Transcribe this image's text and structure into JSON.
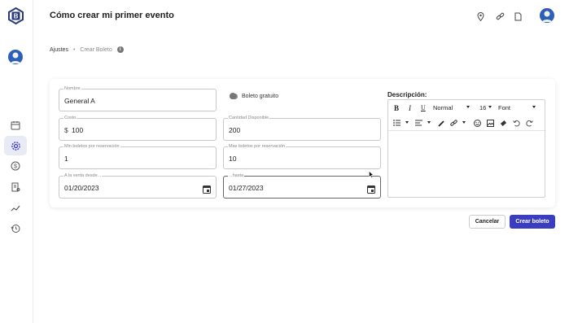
{
  "header": {
    "title": "Cómo crear mi primer evento"
  },
  "breadcrumb": {
    "item1": "Ajustes",
    "separator": "•",
    "item2": "Crear Boleto",
    "info": "i"
  },
  "form": {
    "nombre": {
      "label": "Nombre",
      "value": "General A"
    },
    "boleto_gratuito": {
      "label": "Boleto gratuito"
    },
    "costo": {
      "label": "Costo",
      "prefix": "$",
      "value": "100"
    },
    "cantidad": {
      "label": "Cantidad Disponible",
      "value": "200"
    },
    "min_boletos": {
      "label": "Min boletos por reservación",
      "value": "1"
    },
    "max_boletos": {
      "label": "Max boletos por reservación",
      "value": "10"
    },
    "venta_desde": {
      "label": "A la venta desde...",
      "value": "01/20/2023"
    },
    "hasta": {
      "label": "...hasta",
      "value": "01/27/2023"
    }
  },
  "descripcion": {
    "label": "Descripción:",
    "toolbar": {
      "bold": "B",
      "italic": "I",
      "underline": "U",
      "format": "Normal",
      "size": "16",
      "font": "Font"
    }
  },
  "buttons": {
    "cancel": "Cancelar",
    "create": "Crear boleto"
  },
  "colors": {
    "accent": "#3b3dbf",
    "brand": "#2a3a7a"
  }
}
